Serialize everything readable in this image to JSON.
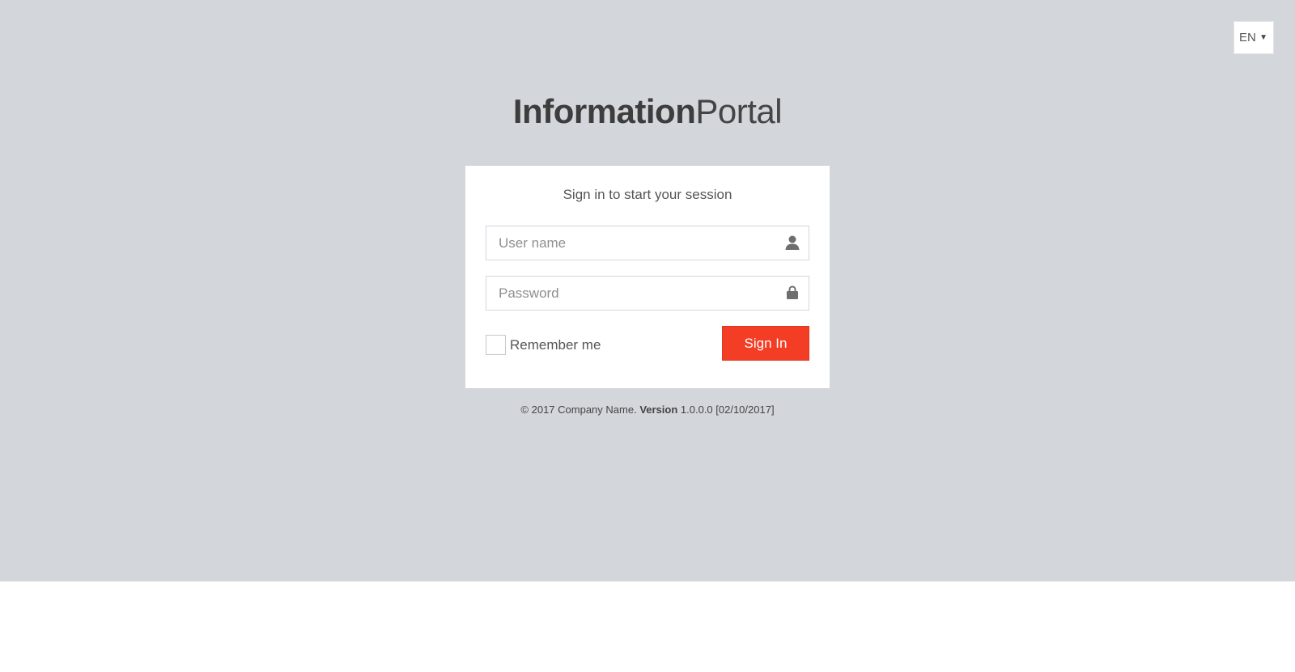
{
  "language": {
    "selected": "EN",
    "caret_icon": "caret-down-icon"
  },
  "logo": {
    "bold": "Information",
    "light": "Portal"
  },
  "login": {
    "message": "Sign in to start your session",
    "username": {
      "value": "",
      "placeholder": "User name",
      "icon": "user-icon"
    },
    "password": {
      "value": "",
      "placeholder": "Password",
      "icon": "lock-icon"
    },
    "remember_label": "Remember me",
    "remember_checked": false,
    "submit_label": "Sign In"
  },
  "footer": {
    "copyright": "© 2017 Company Name.",
    "version_label": "Version",
    "version_value": "1.0.0.0 [02/10/2017]"
  },
  "colors": {
    "background": "#d3d6db",
    "accent": "#f43d25",
    "text": "#555555"
  }
}
